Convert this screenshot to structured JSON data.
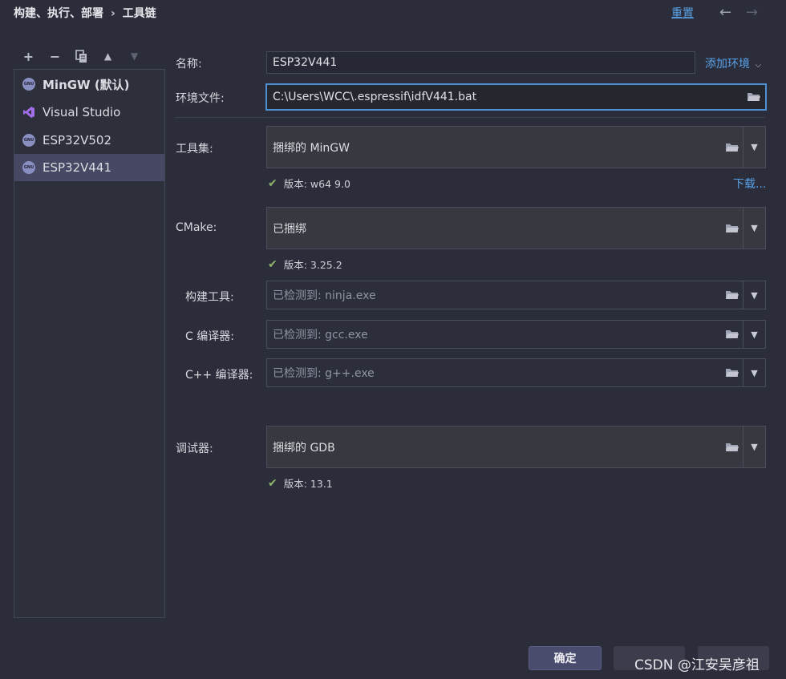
{
  "header": {
    "breadcrumb_parent": "构建、执行、部署",
    "breadcrumb_sep": "›",
    "breadcrumb_current": "工具链",
    "reset_label": "重置",
    "back_arrow": "←",
    "forward_arrow": "→"
  },
  "toolbar": {
    "add": "+",
    "remove": "−",
    "copy_icon": "copy-icon",
    "up": "▲",
    "down": "▼"
  },
  "sidebar": {
    "items": [
      {
        "label": "MinGW (默认)",
        "icon": "gnu-icon",
        "selected": false
      },
      {
        "label": "Visual Studio",
        "icon": "visual-studio-icon",
        "selected": false
      },
      {
        "label": "ESP32V502",
        "icon": "gnu-icon",
        "selected": false
      },
      {
        "label": "ESP32V441",
        "icon": "gnu-icon",
        "selected": true
      }
    ],
    "gnu_badge": "GNU"
  },
  "form": {
    "name_label": "名称:",
    "name_value": "ESP32V441",
    "add_env_label": "添加环境",
    "env_file_label": "环境文件:",
    "env_file_value": "C:\\Users\\WCC\\.espressif\\idfV441.bat",
    "toolset_label": "工具集:",
    "toolset_value": "捆绑的 MinGW",
    "toolset_version": "版本: w64 9.0",
    "download_label": "下载...",
    "cmake_label": "CMake:",
    "cmake_value": "已捆绑",
    "cmake_version": "版本: 3.25.2",
    "build_tool_label": "构建工具:",
    "build_tool_value": "已检测到: ninja.exe",
    "c_compiler_label": "C 编译器:",
    "c_compiler_value": "已检测到: gcc.exe",
    "cpp_compiler_label": "C++ 编译器:",
    "cpp_compiler_value": "已检测到: g++.exe",
    "debugger_label": "调试器:",
    "debugger_value": "捆绑的 GDB",
    "debugger_version": "版本: 13.1"
  },
  "footer": {
    "ok_label": "确定",
    "watermark": "CSDN @江安吴彦祖"
  },
  "colors": {
    "background": "#2b2d3a",
    "accent_link": "#5aa2e8",
    "focus_border": "#4f8fd3",
    "selected_row": "#474863",
    "check_green": "#8fb46c"
  }
}
